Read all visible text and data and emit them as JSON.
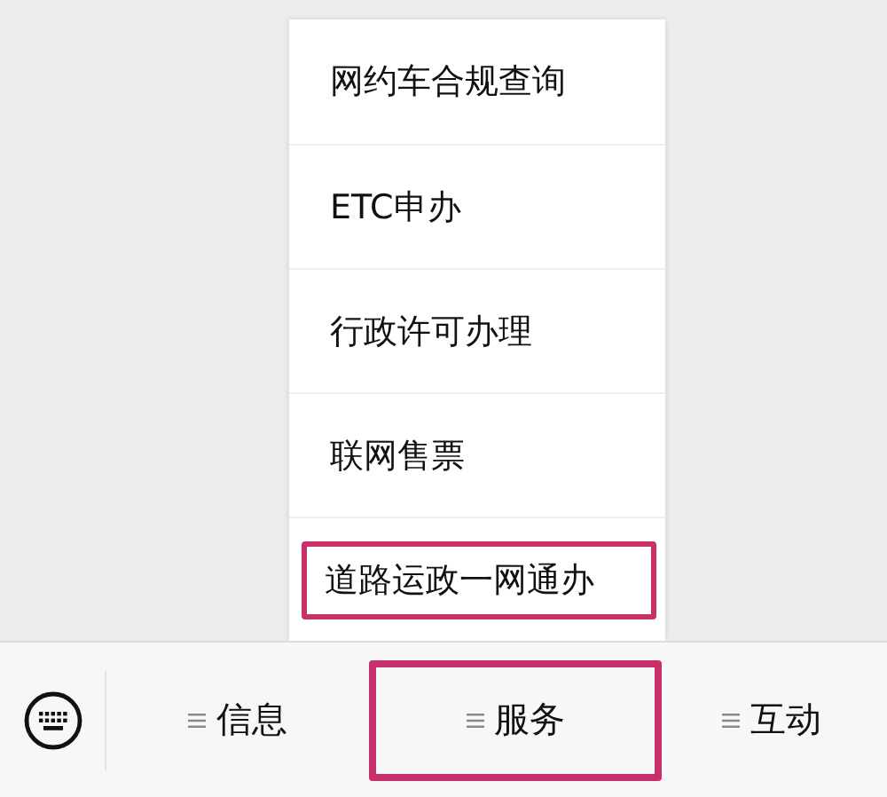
{
  "menu": {
    "items": [
      {
        "label": "网约车合规查询",
        "highlighted": false
      },
      {
        "label": "ETC申办",
        "highlighted": false
      },
      {
        "label": "行政许可办理",
        "highlighted": false
      },
      {
        "label": "联网售票",
        "highlighted": false
      },
      {
        "label": "道路运政一网通办",
        "highlighted": true
      }
    ]
  },
  "bottom_bar": {
    "tabs": [
      {
        "label": "信息",
        "highlighted": false
      },
      {
        "label": "服务",
        "highlighted": true
      },
      {
        "label": "互动",
        "highlighted": false
      }
    ]
  }
}
